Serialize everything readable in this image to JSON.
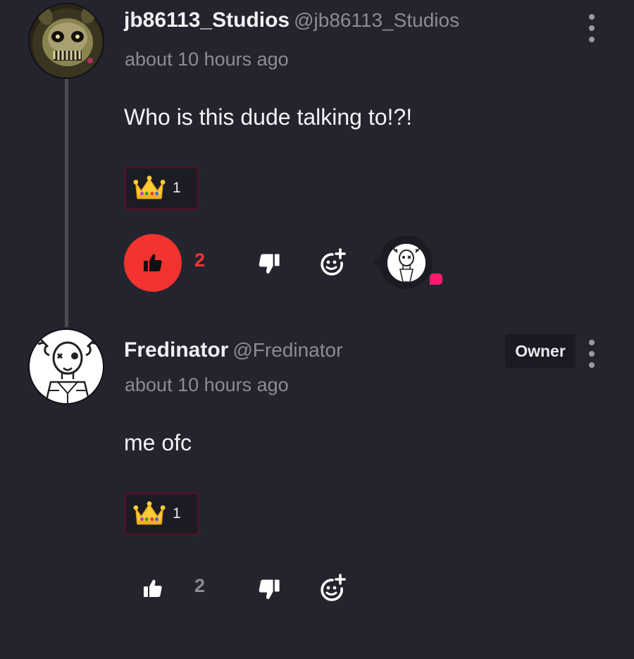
{
  "comments": [
    {
      "username": "jb86113_Studios",
      "handle": "@jb86113_Studios",
      "time": "about 10 hours ago",
      "text": "Who is this dude talking to!?!",
      "reaction": {
        "emoji": "crown-emoji",
        "count": "1"
      },
      "likes": "2",
      "liked": true,
      "avatar_icon": "springtrap-avatar"
    },
    {
      "username": "Fredinator",
      "handle": "@Fredinator",
      "time": "about 10 hours ago",
      "text": "me ofc",
      "badge": "Owner",
      "reaction": {
        "emoji": "crown-emoji",
        "count": "1"
      },
      "likes": "2",
      "liked": false,
      "avatar_icon": "sketch-avatar"
    }
  ],
  "colors": {
    "background": "#24242f",
    "like_active": "#f2332f",
    "notification": "#ff1a6b",
    "muted": "#8c8c96"
  }
}
